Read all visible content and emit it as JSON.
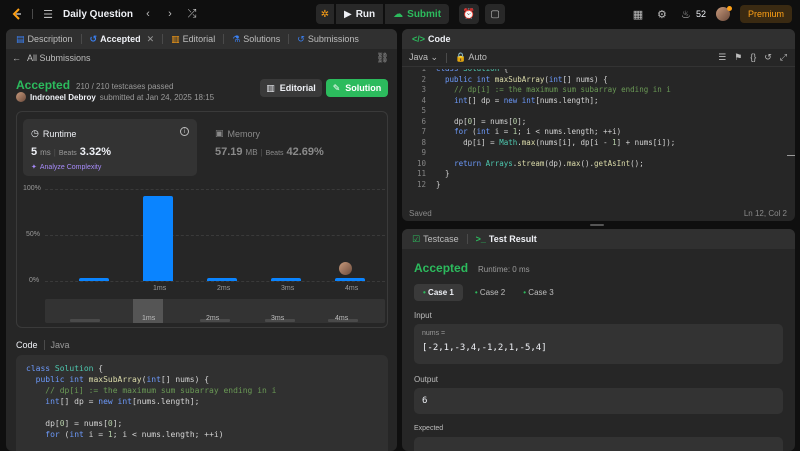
{
  "topbar": {
    "title": "Daily Question",
    "run": "Run",
    "submit": "Submit",
    "streak": "52",
    "premium": "Premium"
  },
  "left_tabs": [
    {
      "label": "Description"
    },
    {
      "label": "Accepted"
    },
    {
      "label": "Editorial"
    },
    {
      "label": "Solutions"
    },
    {
      "label": "Submissions"
    }
  ],
  "submission": {
    "back": "All Submissions",
    "status": "Accepted",
    "passed": "210 / 210 testcases passed",
    "user": "Indroneel Debroy",
    "submitted": "submitted at Jan 24, 2025 18:15",
    "editorial_btn": "Editorial",
    "solution_btn": "Solution",
    "runtime_label": "Runtime",
    "runtime_value": "5",
    "runtime_unit": "ms",
    "beats_label": "Beats",
    "runtime_beats": "3.32%",
    "analyze": "Analyze Complexity",
    "memory_label": "Memory",
    "memory_value": "57.19",
    "memory_unit": "MB",
    "memory_beats": "42.69%"
  },
  "chart_data": {
    "type": "bar",
    "y_ticks": [
      "100%",
      "50%",
      "0%"
    ],
    "ylim": [
      0,
      100
    ],
    "categories": [
      "",
      "1ms",
      "2ms",
      "3ms",
      "4ms"
    ],
    "values": [
      3,
      92,
      3,
      3,
      3
    ],
    "mini_labels": [
      "1ms",
      "2ms",
      "3ms",
      "4ms"
    ]
  },
  "code_section": {
    "label": "Code",
    "lang": "Java"
  },
  "left_code": [
    "class Solution {",
    "  public int maxSubArray(int[] nums) {",
    "    // dp[i] := the maximum sum subarray ending in i",
    "    int[] dp = new int[nums.length];",
    "",
    "    dp[0] = nums[0];",
    "    for (int i = 1; i < nums.length; ++i)"
  ],
  "editor": {
    "title": "Code",
    "lang": "Java",
    "mode": "Auto",
    "saved": "Saved",
    "pos": "Ln 12, Col 2"
  },
  "editor_code": [
    "class Solution {",
    "  public int maxSubArray(int[] nums) {",
    "    // dp[i] := the maximum sum subarray ending in i",
    "    int[] dp = new int[nums.length];",
    "",
    "    dp[0] = nums[0];",
    "    for (int i = 1; i < nums.length; ++i)",
    "      dp[i] = Math.max(nums[i], dp[i - 1] + nums[i]);",
    "",
    "    return Arrays.stream(dp).max().getAsInt();",
    "  }",
    "}"
  ],
  "result": {
    "testcase_tab": "Testcase",
    "result_tab": "Test Result",
    "status": "Accepted",
    "runtime": "Runtime: 0 ms",
    "cases": [
      "Case 1",
      "Case 2",
      "Case 3"
    ],
    "input_label": "Input",
    "var_name": "nums =",
    "input_value": "[-2,1,-3,4,-1,2,1,-5,4]",
    "output_label": "Output",
    "output_value": "6",
    "expected_label": "Expected"
  },
  "colors": {
    "accent": "#ffa116",
    "green": "#2cbb5d",
    "bar": "#0a84ff"
  }
}
